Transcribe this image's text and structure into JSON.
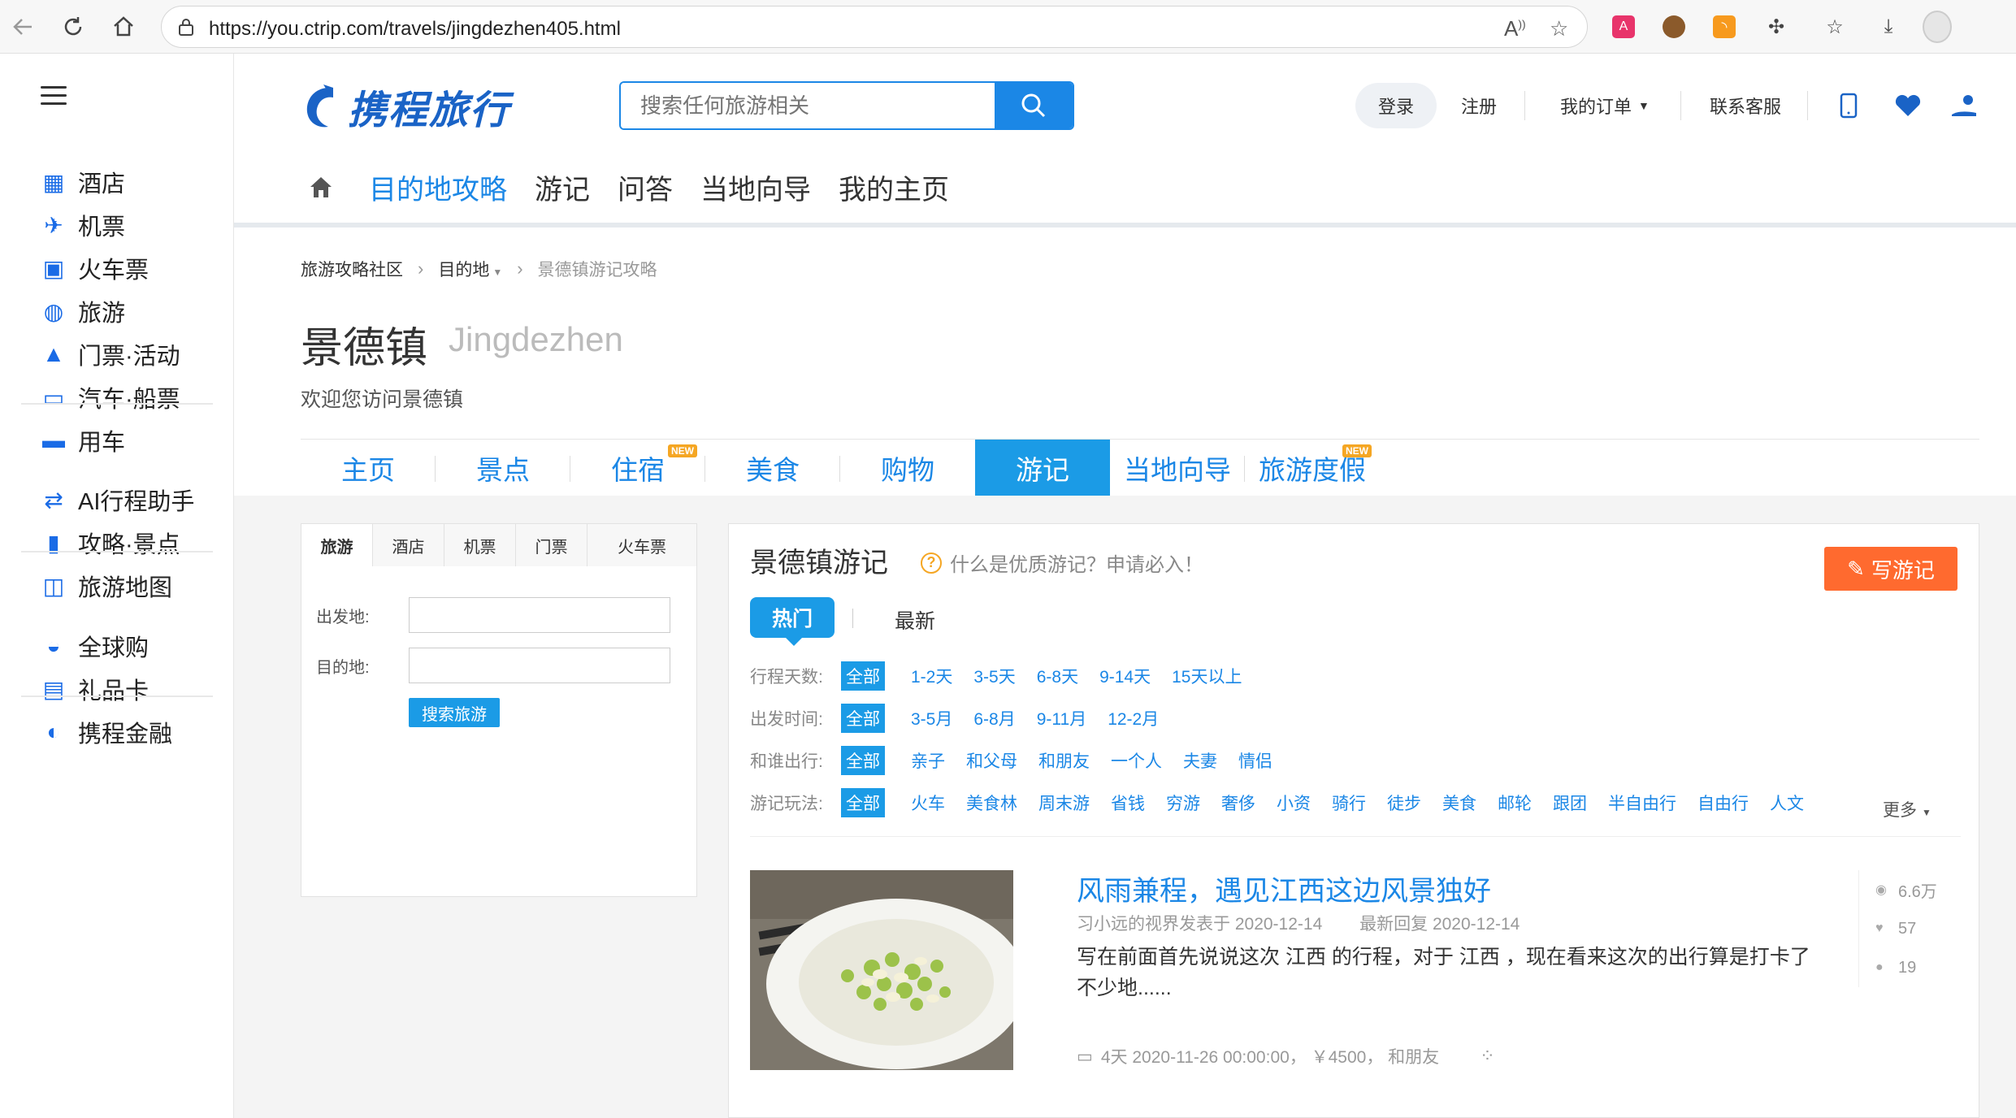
{
  "browser": {
    "url": "https://you.ctrip.com/travels/jingdezhen405.html",
    "icons": [
      "back-icon",
      "reload-icon",
      "home-icon",
      "lock-icon",
      "read-aloud-icon",
      "favorite-icon",
      "translate-extension-icon",
      "cookie-extension-icon",
      "rss-extension-icon",
      "extensions-icon",
      "favorites-icon",
      "downloads-icon",
      "profile-icon"
    ]
  },
  "sidebar": {
    "items": [
      {
        "label": "酒店",
        "icon": "hotel-icon"
      },
      {
        "label": "机票",
        "icon": "plane-icon"
      },
      {
        "label": "火车票",
        "icon": "train-icon"
      },
      {
        "label": "旅游",
        "icon": "travel-icon"
      },
      {
        "label": "门票·活动",
        "icon": "ticket-icon"
      },
      {
        "label": "汽车·船票",
        "icon": "bus-icon"
      },
      {
        "label": "用车",
        "icon": "car-icon"
      },
      {
        "label": "AI行程助手",
        "icon": "ai-assistant-icon"
      },
      {
        "label": "攻略·景点",
        "icon": "guide-icon"
      },
      {
        "label": "旅游地图",
        "icon": "map-icon"
      },
      {
        "label": "全球购",
        "icon": "global-shop-icon"
      },
      {
        "label": "礼品卡",
        "icon": "gift-card-icon"
      },
      {
        "label": "携程金融",
        "icon": "finance-icon"
      }
    ]
  },
  "header": {
    "logo_text": "携程旅行",
    "search_placeholder": "搜索任何旅游相关",
    "login": "登录",
    "register": "注册",
    "orders": "我的订单",
    "service": "联系客服",
    "brand_color": "#1b87e6"
  },
  "mainnav": [
    "目的地攻略",
    "游记",
    "问答",
    "当地向导",
    "我的主页"
  ],
  "breadcrumb": [
    "旅游攻略社区",
    "目的地",
    "景德镇游记攻略"
  ],
  "dest": {
    "title": "景德镇",
    "title_en": "Jingdezhen",
    "welcome": "欢迎您访问景德镇"
  },
  "subtabs": [
    {
      "label": "主页",
      "new": ""
    },
    {
      "label": "景点",
      "new": ""
    },
    {
      "label": "住宿",
      "new": "NEW"
    },
    {
      "label": "美食",
      "new": ""
    },
    {
      "label": "购物",
      "new": ""
    },
    {
      "label": "游记",
      "new": ""
    },
    {
      "label": "当地向导",
      "new": ""
    },
    {
      "label": "旅游度假",
      "new": "NEW"
    }
  ],
  "booking": {
    "tabs": [
      "旅游",
      "酒店",
      "机票",
      "门票",
      "火车票"
    ],
    "from_label": "出发地:",
    "to_label": "目的地:",
    "submit": "搜索旅游"
  },
  "travels": {
    "title": "景德镇游记",
    "help": "什么是优质游记？申请必入！",
    "write": "写游记",
    "sort_hot": "热门",
    "sort_new": "最新",
    "filters": [
      {
        "label": "行程天数:",
        "all": "全部",
        "options": [
          "1-2天",
          "3-5天",
          "6-8天",
          "9-14天",
          "15天以上"
        ]
      },
      {
        "label": "出发时间:",
        "all": "全部",
        "options": [
          "3-5月",
          "6-8月",
          "9-11月",
          "12-2月"
        ]
      },
      {
        "label": "和谁出行:",
        "all": "全部",
        "options": [
          "亲子",
          "和父母",
          "和朋友",
          "一个人",
          "夫妻",
          "情侣"
        ]
      },
      {
        "label": "游记玩法:",
        "all": "全部",
        "options": [
          "火车",
          "美食林",
          "周末游",
          "省钱",
          "穷游",
          "奢侈",
          "小资",
          "骑行",
          "徒步",
          "美食",
          "邮轮",
          "跟团",
          "半自由行",
          "自由行",
          "人文"
        ]
      }
    ],
    "more": "更多",
    "article": {
      "title": "风雨兼程，遇见江西这边风景独好",
      "author_line": "习小远的视界发表于 2020-12-14",
      "reply_line": "最新回复 2020-12-14",
      "body": "写在前面首先说说这次 江西 的行程，对于 江西 ，现在看来这次的出行算是打卡了不少地......",
      "foot": "4天 2020-11-26 00:00:00， ￥4500， 和朋友",
      "views": "6.6万",
      "likes": "57",
      "comments": "19"
    }
  }
}
